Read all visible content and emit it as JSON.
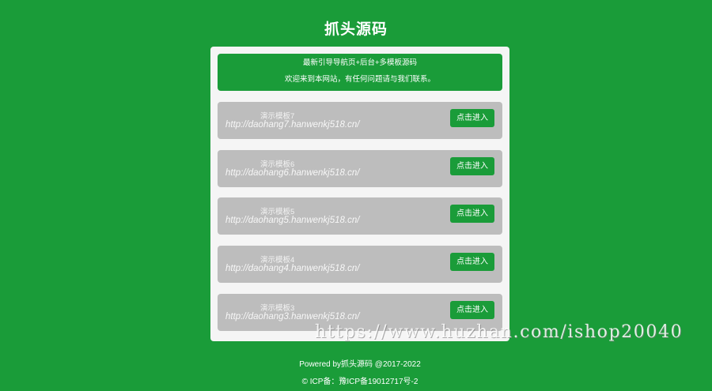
{
  "site": {
    "title": "抓头源码"
  },
  "notice": {
    "line1": "最新引导导航页+后台+多模板源码",
    "line2": "欢迎来到本网站，有任何问题请与我们联系。"
  },
  "items": [
    {
      "name": "演示模板7",
      "url": "http://daohang7.hanwenkj518.cn/",
      "button": "点击进入"
    },
    {
      "name": "演示模板6",
      "url": "http://daohang6.hanwenkj518.cn/",
      "button": "点击进入"
    },
    {
      "name": "演示模板5",
      "url": "http://daohang5.hanwenkj518.cn/",
      "button": "点击进入"
    },
    {
      "name": "演示模板4",
      "url": "http://daohang4.hanwenkj518.cn/",
      "button": "点击进入"
    },
    {
      "name": "演示模板3",
      "url": "http://daohang3.hanwenkj518.cn/",
      "button": "点击进入"
    }
  ],
  "footer": {
    "powered": "Powered by抓头源码 @2017-2022",
    "icp": "© ICP备：豫ICP备19012717号-2"
  },
  "watermark": {
    "text": "https://www.huzhan.com/ishop20040"
  },
  "colors": {
    "background": "#1a9c39",
    "card": "#f5f5f5",
    "item": "#bdbdbd",
    "button": "#1a9c39"
  }
}
